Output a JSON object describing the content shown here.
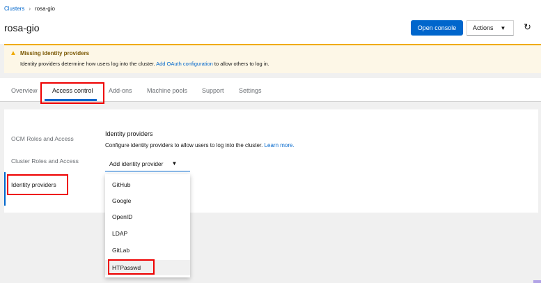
{
  "breadcrumb": {
    "parent": "Clusters",
    "current": "rosa-gio"
  },
  "page": {
    "title": "rosa-gio"
  },
  "header_buttons": {
    "open_console": "Open console",
    "actions": "Actions"
  },
  "alert": {
    "title": "Missing identity providers",
    "body_prefix": "Identity providers determine how users log into the cluster. ",
    "body_link": "Add OAuth configuration",
    "body_suffix": " to allow others to log in."
  },
  "tabs": [
    "Overview",
    "Access control",
    "Add-ons",
    "Machine pools",
    "Support",
    "Settings"
  ],
  "active_tab": "Access control",
  "sidebar": {
    "items": [
      "OCM Roles and Access",
      "Cluster Roles and Access",
      "Identity providers"
    ],
    "active": "Identity providers"
  },
  "section": {
    "title": "Identity providers",
    "description": "Configure identity providers to allow users to log into the cluster. ",
    "learn_more": "Learn more."
  },
  "select": {
    "label": "Add identity provider"
  },
  "menu": {
    "items": [
      "GitHub",
      "Google",
      "OpenID",
      "LDAP",
      "GitLab",
      "HTPasswd"
    ],
    "hovered": "HTPasswd"
  },
  "colors": {
    "primary": "#0066cc",
    "warning": "#f0ab00",
    "highlight": "#ee0000"
  }
}
